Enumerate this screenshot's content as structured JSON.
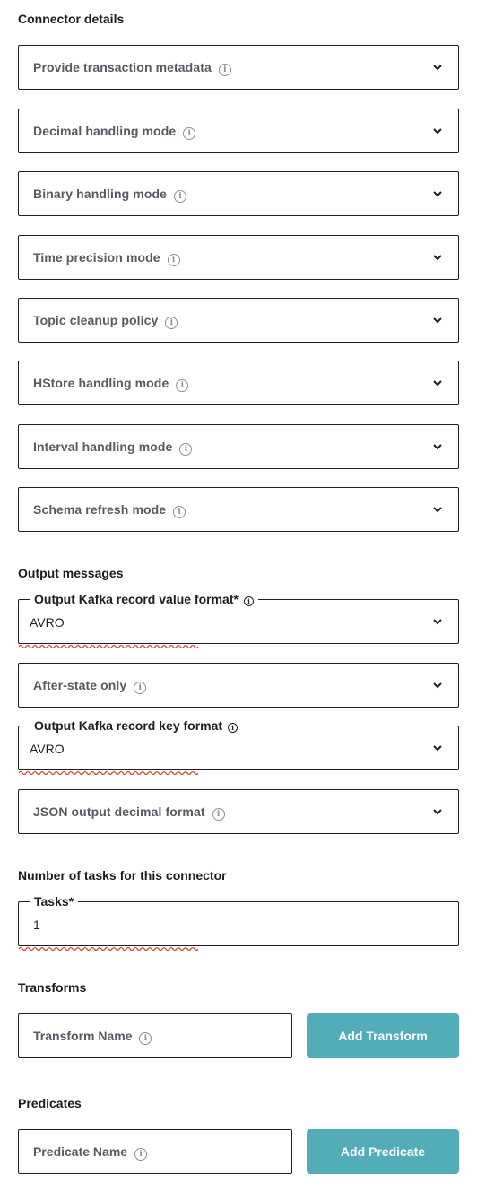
{
  "sections": {
    "connector_details": "Connector details",
    "output_messages": "Output messages",
    "tasks": "Number of tasks for this connector",
    "transforms": "Transforms",
    "predicates": "Predicates"
  },
  "connector_selects": [
    {
      "label": "Provide transaction metadata"
    },
    {
      "label": "Decimal handling mode"
    },
    {
      "label": "Binary handling mode"
    },
    {
      "label": "Time precision mode"
    },
    {
      "label": "Topic cleanup policy"
    },
    {
      "label": "HStore handling mode"
    },
    {
      "label": "Interval handling mode"
    },
    {
      "label": "Schema refresh mode"
    }
  ],
  "output": {
    "value_format": {
      "legend": "Output Kafka record value format*",
      "value": "AVRO"
    },
    "after_state": {
      "label": "After-state only"
    },
    "key_format": {
      "legend": "Output Kafka record key format",
      "value": "AVRO"
    },
    "json_decimal": {
      "label": "JSON output decimal format"
    }
  },
  "tasks_field": {
    "legend": "Tasks*",
    "value": "1"
  },
  "transform": {
    "placeholder": "Transform Name",
    "button": "Add Transform"
  },
  "predicate": {
    "placeholder": "Predicate Name",
    "button": "Add Predicate"
  },
  "icons": {
    "info": "info-icon",
    "chevron": "chevron-down-icon"
  },
  "colors": {
    "button": "#52adb8",
    "spellcheck": "#d9412b"
  }
}
